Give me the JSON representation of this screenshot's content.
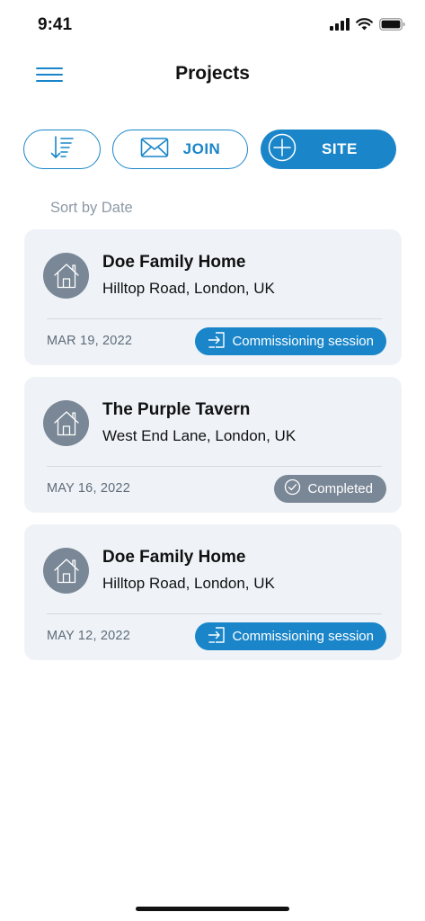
{
  "status_bar": {
    "time": "9:41"
  },
  "header": {
    "title": "Projects"
  },
  "actions": {
    "sort_icon": "sort-descending-icon",
    "join_label": "JOIN",
    "join_icon": "envelope-icon",
    "site_label": "SITE",
    "site_icon": "plus-circle-icon"
  },
  "sort": {
    "label": "Sort by Date"
  },
  "colors": {
    "accent": "#1a86c9",
    "card_bg": "#eff3f8",
    "muted_badge": "#7a8796"
  },
  "projects": [
    {
      "name": "Doe Family Home",
      "address": "Hilltop Road, London, UK",
      "date": "MAR 19, 2022",
      "status": "Commissioning session",
      "status_type": "session"
    },
    {
      "name": "The Purple Tavern",
      "address": "West End Lane, London, UK",
      "date": "MAY 16, 2022",
      "status": "Completed",
      "status_type": "completed"
    },
    {
      "name": "Doe Family Home",
      "address": "Hilltop Road, London, UK",
      "date": "MAY 12, 2022",
      "status": "Commissioning session",
      "status_type": "session"
    }
  ]
}
